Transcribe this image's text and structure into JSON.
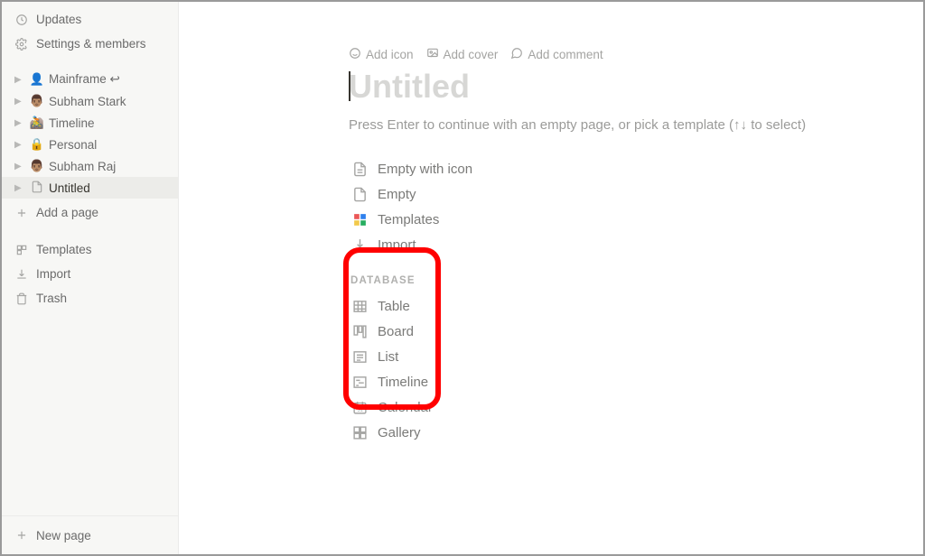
{
  "sidebar": {
    "updates": "Updates",
    "settings": "Settings & members",
    "pages": [
      {
        "emoji": "👤",
        "label": "Mainframe ↩",
        "emoji_name": "person-icon"
      },
      {
        "emoji": "👨🏽",
        "label": "Subham Stark",
        "emoji_name": "avatar-icon"
      },
      {
        "emoji": "🚵",
        "label": "Timeline",
        "emoji_name": "biking-icon"
      },
      {
        "emoji": "🔒",
        "label": "Personal",
        "emoji_name": "lock-icon"
      },
      {
        "emoji": "👨🏽",
        "label": "Subham Raj",
        "emoji_name": "avatar-icon"
      },
      {
        "emoji": "",
        "label": "Untitled",
        "emoji_name": "page-icon",
        "selected": true
      }
    ],
    "add_page": "Add a page",
    "templates": "Templates",
    "import": "Import",
    "trash": "Trash",
    "new_page": "New page"
  },
  "hover_actions": {
    "add_icon": "Add icon",
    "add_cover": "Add cover",
    "add_comment": "Add comment"
  },
  "title_placeholder": "Untitled",
  "hint": "Press Enter to continue with an empty page, or pick a template (↑↓ to select)",
  "options": {
    "empty_with_icon": "Empty with icon",
    "empty": "Empty",
    "templates": "Templates",
    "import": "Import"
  },
  "database_section_label": "DATABASE",
  "database_options": {
    "table": "Table",
    "board": "Board",
    "list": "List",
    "timeline": "Timeline",
    "calendar": "Calendar",
    "gallery": "Gallery"
  }
}
